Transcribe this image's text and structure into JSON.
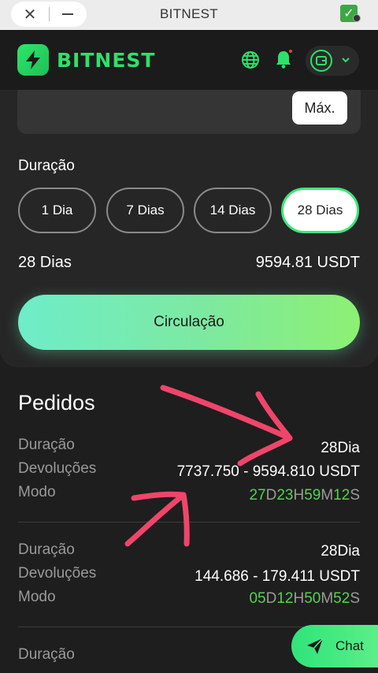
{
  "browser": {
    "title": "BITNEST",
    "close_glyph": "✕",
    "check_glyph": "✓",
    "icons": [
      "close-icon",
      "minimize-icon",
      "check-icon"
    ]
  },
  "header": {
    "logo_text": "BITNEST",
    "accent": "#2ee06a",
    "icons": [
      "logo-icon",
      "globe-icon",
      "bell-icon",
      "wallet-icon",
      "chevron-down-icon"
    ]
  },
  "invest": {
    "max_label": "Máx.",
    "duration_label": "Duração",
    "durations": [
      "1 Dia",
      "7 Dias",
      "14 Dias",
      "28 Dias"
    ],
    "selected_duration": "28 Dias",
    "summary_days": "28 Dias",
    "summary_amount": "9594.81 USDT",
    "action_label": "Circulação"
  },
  "orders": {
    "title": "Pedidos",
    "labels": {
      "duration": "Duração",
      "returns": "Devoluções",
      "mode": "Modo"
    },
    "items": [
      {
        "duration": "28Dia",
        "returns": "7737.750 - 9594.810 USDT",
        "timer": {
          "d": "27",
          "h": "23",
          "m": "59",
          "s": "12"
        }
      },
      {
        "duration": "28Dia",
        "returns": "144.686 - 179.411 USDT",
        "timer": {
          "d": "05",
          "h": "12",
          "m": "50",
          "s": "52"
        }
      },
      {
        "duration_label_only": "Duração"
      }
    ],
    "timer_units": {
      "d": "D",
      "h": "H",
      "m": "M",
      "s": "S"
    }
  },
  "chat": {
    "label": "Chat",
    "icon": "send-icon"
  },
  "colors": {
    "timer_green": "#54d34f",
    "annotation_arrow": "#f0456a"
  }
}
